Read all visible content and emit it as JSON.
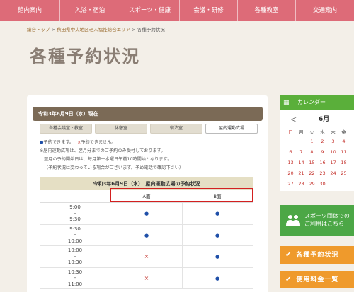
{
  "nav": {
    "items": [
      "館内案内",
      "入浴・宿泊",
      "スポーツ・健康",
      "会議・研修",
      "各種教室",
      "交通案内"
    ]
  },
  "breadcrumb": {
    "home": "総合トップ",
    "separator1": " > ",
    "parent": "秋田県中央地区老人福祉総合エリア",
    "separator2": " > ",
    "current": "各種予約状況"
  },
  "page_title": "各種予約状況",
  "reservation": {
    "status_date": "令和3年6月9日（水）現在",
    "tabs": [
      "各種会議室・教室",
      "休憩室",
      "宿泊室",
      "屋内運動広場"
    ],
    "active_tab": 3,
    "legend_ok": "●",
    "legend_ok_text": "予約できます。",
    "legend_ng": "×",
    "legend_ng_text": "予約できません。",
    "note1": "※屋内運動広場は、翌月分までのご予約のみ受付しております。",
    "note2": "翌月の予約開始日は、毎月第一水曜日午前10時開始となります。",
    "note3": "（予約状況は変わっている場合がございます。予め電話で確認下さい）",
    "table_title": "令和3年6月9日（水）　屋内運動広場の予約状況",
    "area_a": "A面",
    "area_b": "B面",
    "slots": [
      {
        "start": "9:00",
        "dash": "-",
        "end": "9:30",
        "a": "●",
        "b": "●"
      },
      {
        "start": "9:30",
        "dash": "-",
        "end": "10:00",
        "a": "●",
        "b": "●"
      },
      {
        "start": "10:00",
        "dash": "-",
        "end": "10:30",
        "a": "×",
        "b": "●"
      },
      {
        "start": "10:30",
        "dash": "-",
        "end": "11:00",
        "a": "×",
        "b": "●"
      }
    ]
  },
  "calendar": {
    "title": "カレンダー",
    "prev": "＜",
    "month": "6月",
    "weekdays": [
      "日",
      "月",
      "火",
      "水",
      "木",
      "金"
    ],
    "rows": [
      [
        "",
        "",
        "1",
        "2",
        "3",
        "4"
      ],
      [
        "6",
        "7",
        "8",
        "9",
        "10",
        "11"
      ],
      [
        "13",
        "14",
        "15",
        "16",
        "17",
        "18"
      ],
      [
        "20",
        "21",
        "22",
        "23",
        "24",
        "25"
      ],
      [
        "27",
        "28",
        "29",
        "30",
        "",
        ""
      ]
    ]
  },
  "banners": {
    "sports_line1": "スポーツ団体での",
    "sports_line2": "ご利用はこちら",
    "reservation_status": "各種予約状況",
    "fees": "使用料金一覧"
  },
  "colors": {
    "nav": "#dd6b78",
    "status_bar": "#7b6a56",
    "calendar_green": "#5aaf3a",
    "orange": "#ef9a2c",
    "highlight": "#d32020"
  }
}
